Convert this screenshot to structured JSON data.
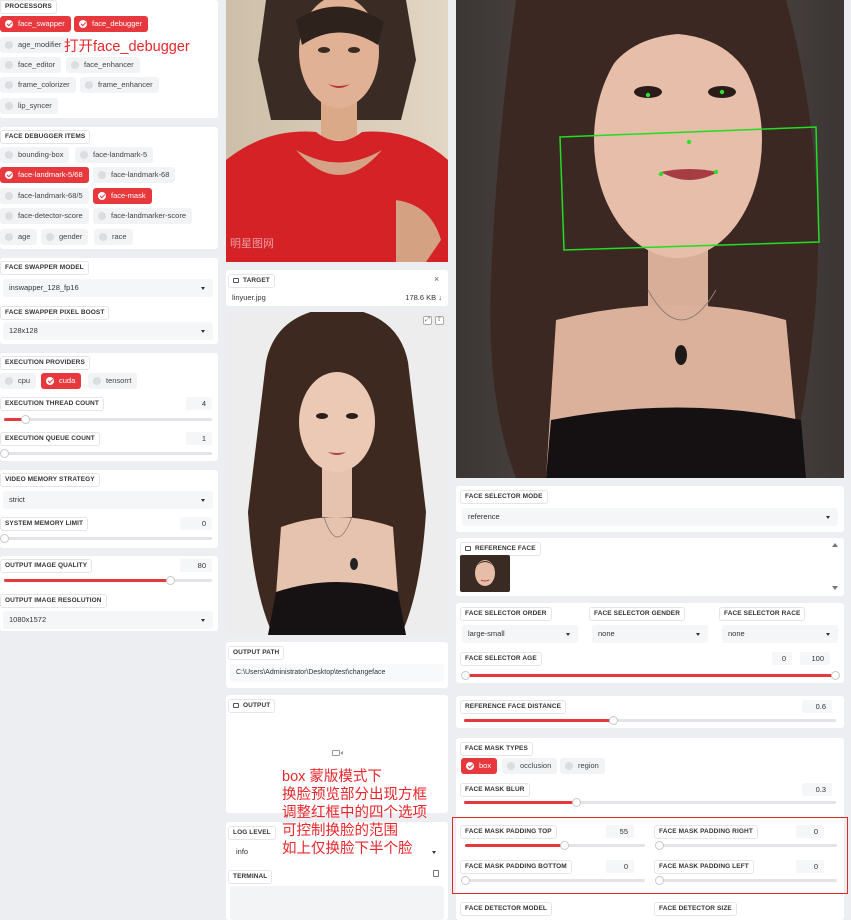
{
  "processors": {
    "label": "PROCESSORS",
    "items": [
      "face_swapper",
      "face_debugger",
      "age_modifier",
      "face_editor",
      "face_enhancer",
      "frame_colorizer",
      "frame_enhancer",
      "lip_syncer"
    ]
  },
  "annotation_top": "打开face_debugger",
  "face_debugger_items": {
    "label": "FACE DEBUGGER ITEMS",
    "items": [
      "bounding-box",
      "face-landmark-5",
      "face-landmark-5/68",
      "face-landmark-68",
      "face-landmark-68/5",
      "face-mask",
      "face-detector-score",
      "face-landmarker-score",
      "age",
      "gender",
      "race"
    ]
  },
  "face_swapper_model": {
    "label": "FACE SWAPPER MODEL",
    "value": "inswapper_128_fp16"
  },
  "face_swapper_pixel_boost": {
    "label": "FACE SWAPPER PIXEL BOOST",
    "value": "128x128"
  },
  "execution_providers": {
    "label": "EXECUTION PROVIDERS",
    "items": [
      "cpu",
      "cuda",
      "tensorrt"
    ]
  },
  "execution_thread_count": {
    "label": "EXECUTION THREAD COUNT",
    "value": "4",
    "fraction": 0.1
  },
  "execution_queue_count": {
    "label": "EXECUTION QUEUE COUNT",
    "value": "1",
    "fraction": 0.0
  },
  "video_memory_strategy": {
    "label": "VIDEO MEMORY STRATEGY",
    "value": "strict"
  },
  "system_memory_limit": {
    "label": "SYSTEM MEMORY LIMIT",
    "value": "0",
    "fraction": 0.0
  },
  "output_image_quality": {
    "label": "OUTPUT IMAGE QUALITY",
    "value": "80",
    "fraction": 0.8
  },
  "output_image_resolution": {
    "label": "OUTPUT IMAGE RESOLUTION",
    "value": "1080x1572"
  },
  "source_watermark": "明星图网",
  "target": {
    "label": "TARGET",
    "filename": "linyuer.jpg",
    "size": "178.6 KB ↓"
  },
  "output_path": {
    "label": "OUTPUT PATH",
    "value": "C:\\Users\\Administrator\\Desktop\\test\\changeface"
  },
  "output": {
    "label": "OUTPUT"
  },
  "annotation_box": [
    "box 蒙版模式下",
    "换脸预览部分出现方框",
    "调整红框中的四个选项",
    "可控制换脸的范围",
    "如上仅换脸下半个脸"
  ],
  "log_level": {
    "label": "LOG LEVEL",
    "value": "info"
  },
  "terminal": {
    "label": "TERMINAL"
  },
  "face_selector_mode": {
    "label": "FACE SELECTOR MODE",
    "value": "reference"
  },
  "reference_face": {
    "label": "REFERENCE FACE"
  },
  "face_selector_order": {
    "label": "FACE SELECTOR ORDER",
    "value": "large-small"
  },
  "face_selector_gender": {
    "label": "FACE SELECTOR GENDER",
    "value": "none"
  },
  "face_selector_race": {
    "label": "FACE SELECTOR RACE",
    "value": "none"
  },
  "face_selector_age": {
    "label": "FACE SELECTOR AGE",
    "min": "0",
    "max": "100"
  },
  "reference_face_distance": {
    "label": "REFERENCE FACE DISTANCE",
    "value": "0.6",
    "fraction": 0.4
  },
  "face_mask_types": {
    "label": "FACE MASK TYPES",
    "items": [
      "box",
      "occlusion",
      "region"
    ]
  },
  "face_mask_blur": {
    "label": "FACE MASK BLUR",
    "value": "0.3",
    "fraction": 0.3
  },
  "face_mask_padding_top": {
    "label": "FACE MASK PADDING TOP",
    "value": "55",
    "fraction": 0.55
  },
  "face_mask_padding_right": {
    "label": "FACE MASK PADDING RIGHT",
    "value": "0",
    "fraction": 0.0
  },
  "face_mask_padding_bottom": {
    "label": "FACE MASK PADDING BOTTOM",
    "value": "0",
    "fraction": 0.0
  },
  "face_mask_padding_left": {
    "label": "FACE MASK PADDING LEFT",
    "value": "0",
    "fraction": 0.0
  },
  "face_detector_model": {
    "label": "FACE DETECTOR MODEL"
  },
  "face_detector_size": {
    "label": "FACE DETECTOR SIZE"
  },
  "colors": {
    "accent": "#e7383e",
    "annotation": "#e8262b",
    "debug_box": "#22dd22"
  }
}
